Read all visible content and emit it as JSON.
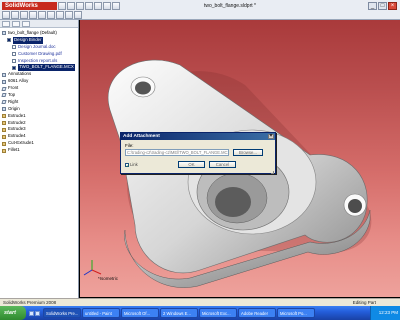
{
  "app": {
    "logo": "SolidWorks",
    "title": "two_bolt_flange.sldprt *"
  },
  "window_buttons": [
    "_",
    "□",
    "×"
  ],
  "feature_tree": {
    "items": [
      {
        "label": "two_bolt_flange  (Default)",
        "indent": 0,
        "icon": "part-icon"
      },
      {
        "label": "Design Binder",
        "indent": 1,
        "icon": "binder-icon",
        "selected": true
      },
      {
        "label": "Design Journal.doc",
        "indent": 2,
        "icon": "document-icon",
        "link": true
      },
      {
        "label": "Customer Drawing.pdf",
        "indent": 2,
        "icon": "document-icon",
        "link": true
      },
      {
        "label": "Inspection report.xls",
        "indent": 2,
        "icon": "document-icon",
        "link": true
      },
      {
        "label": "TWO_BOLT_FLANGE.MCX",
        "indent": 2,
        "icon": "document-icon",
        "selected": true
      },
      {
        "label": "Annotations",
        "indent": 0,
        "icon": "annotations-icon"
      },
      {
        "label": "6061 Alloy",
        "indent": 0,
        "icon": "material-icon"
      },
      {
        "label": "Front",
        "indent": 0,
        "icon": "plane-icon"
      },
      {
        "label": "Top",
        "indent": 0,
        "icon": "plane-icon"
      },
      {
        "label": "Right",
        "indent": 0,
        "icon": "plane-icon"
      },
      {
        "label": "Origin",
        "indent": 0,
        "icon": "origin-icon"
      },
      {
        "label": "Extrude1",
        "indent": 0,
        "icon": "feature-icon"
      },
      {
        "label": "Extrude2",
        "indent": 0,
        "icon": "feature-icon"
      },
      {
        "label": "Extrude3",
        "indent": 0,
        "icon": "feature-icon"
      },
      {
        "label": "Extrude4",
        "indent": 0,
        "icon": "feature-icon"
      },
      {
        "label": "Cut-Extrude1",
        "indent": 0,
        "icon": "feature-icon"
      },
      {
        "label": "Fillet1",
        "indent": 0,
        "icon": "feature-icon"
      }
    ]
  },
  "viewport": {
    "view_label": "*Isometric"
  },
  "dialog": {
    "title": "Add Attachment",
    "close": "×",
    "file_label": "File:",
    "file_value": "C:\\trading-c2\\trading-c2\\MEl\\TWO_BOLT_FLANGE.MCX",
    "browse_label": "Browse...",
    "link_label": "Link",
    "link_checked": "✓",
    "ok_label": "OK",
    "cancel_label": "Cancel"
  },
  "status_bar": {
    "left": "SolidWorks Premium 2008",
    "right": "Editing Part"
  },
  "taskbar": {
    "start": "start",
    "tasks": [
      "SolidWorks Pre...",
      "untitled - Paint",
      "Microsoft Of...",
      "2 Windows E...",
      "Microsoft Exc...",
      "Adobe Reader",
      "Microsoft Po..."
    ],
    "clock": "12:23 PM"
  },
  "colors": {
    "viewport_top": "#a93a3b",
    "viewport_bottom": "#eea29c",
    "selection": "#0a246a",
    "taskbar": "#245edb"
  }
}
